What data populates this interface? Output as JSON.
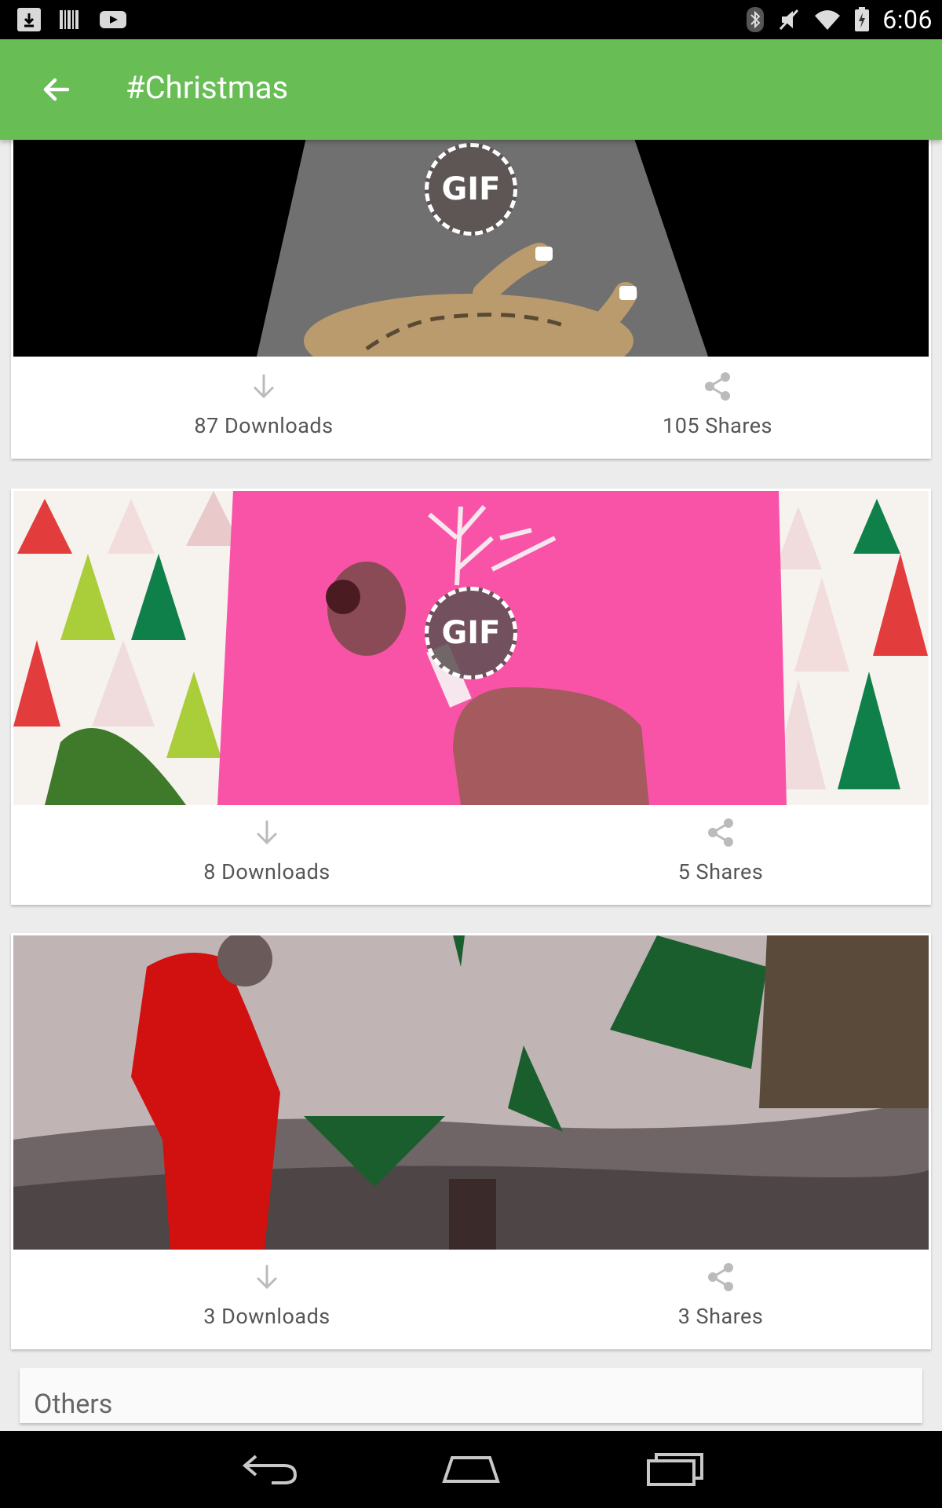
{
  "status_bar": {
    "time": "6:06",
    "left_icons": [
      "download-icon",
      "barcode-icon",
      "youtube-icon"
    ],
    "right_icons": [
      "bluetooth-icon",
      "mute-icon",
      "wifi-icon",
      "battery-icon"
    ]
  },
  "app_bar": {
    "title": "#Christmas",
    "back_icon": "arrow-back-icon",
    "color": "#68bd55"
  },
  "cards": [
    {
      "media": "turkey-gif",
      "badge": "GIF",
      "downloads": "87 Downloads",
      "shares": "105 Shares"
    },
    {
      "media": "reindeer-gif",
      "badge": "GIF",
      "downloads": "8 Downloads",
      "shares": "5 Shares"
    },
    {
      "media": "astronaut-gif",
      "downloads": "3 Downloads",
      "shares": "3 Shares"
    }
  ],
  "section": {
    "others_label": "Others"
  },
  "nav_bar": {
    "icons": [
      "back-nav-icon",
      "home-nav-icon",
      "recents-nav-icon"
    ]
  }
}
